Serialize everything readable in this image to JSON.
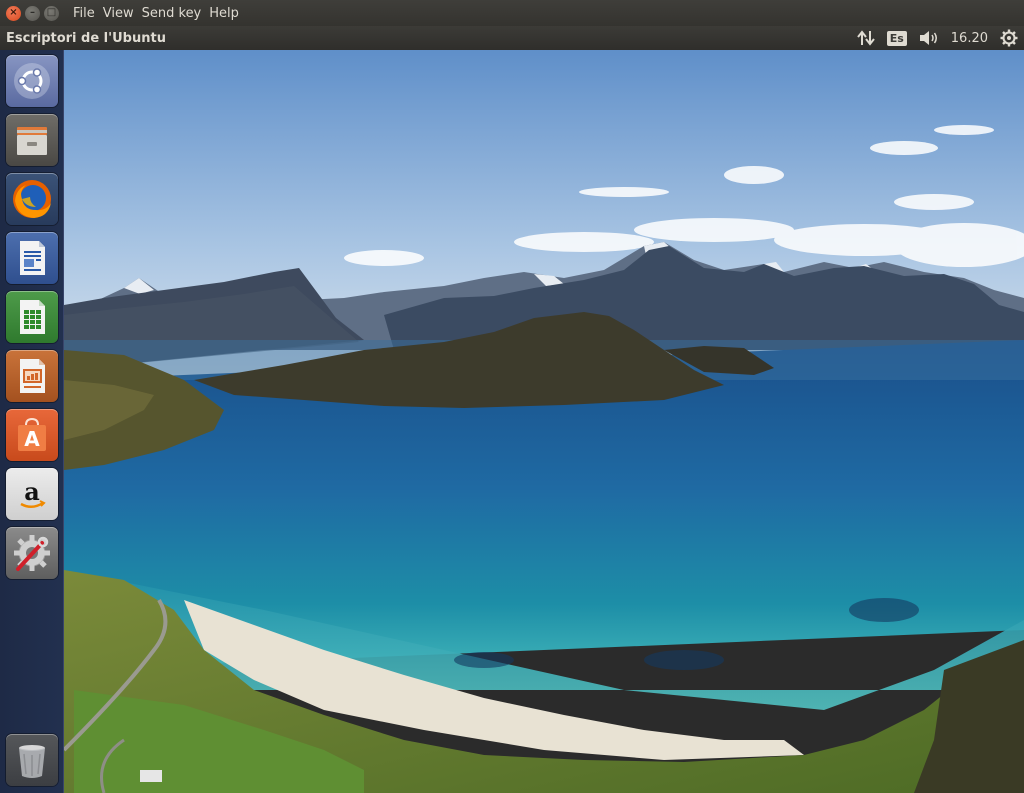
{
  "vm_window": {
    "menu": [
      "File",
      "View",
      "Send key",
      "Help"
    ]
  },
  "panel": {
    "title": "Escriptori de l'Ubuntu",
    "keyboard_layout": "Es",
    "clock": "16.20"
  },
  "launcher": {
    "items": [
      {
        "name": "ubuntu-dash",
        "icon": "ubuntu-logo-icon"
      },
      {
        "name": "files",
        "icon": "file-cabinet-icon"
      },
      {
        "name": "firefox",
        "icon": "firefox-icon"
      },
      {
        "name": "libreoffice-writer",
        "icon": "writer-document-icon"
      },
      {
        "name": "libreoffice-calc",
        "icon": "calc-spreadsheet-icon"
      },
      {
        "name": "libreoffice-impress",
        "icon": "impress-presentation-icon"
      },
      {
        "name": "ubuntu-software",
        "icon": "software-bag-icon"
      },
      {
        "name": "amazon",
        "icon": "amazon-icon"
      },
      {
        "name": "system-settings",
        "icon": "settings-gear-wrench-icon"
      },
      {
        "name": "trash",
        "icon": "trash-icon"
      }
    ]
  },
  "colors": {
    "panel_bg": "#3c3b37",
    "launcher_bg": "#1e2a46",
    "close_button": "#e95420",
    "text": "#dfdbd2"
  },
  "wallpaper": "coastal fjord with mountains, turquoise bay and white sand beach"
}
